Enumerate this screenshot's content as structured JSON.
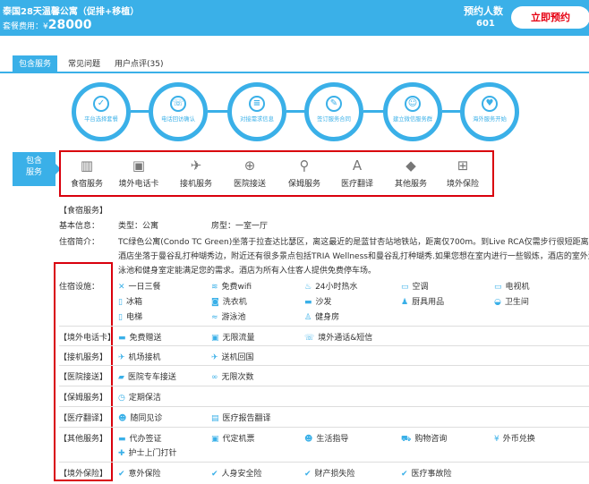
{
  "header": {
    "title": "泰国28天温馨公寓（促排+移植）",
    "fee_label": "套餐费用：¥",
    "fee_value": "28000",
    "count_label": "预约人数",
    "count_value": "601",
    "book_button": "立即预约"
  },
  "tabs": [
    "包含服务",
    "常见问题",
    "用户点评(35)"
  ],
  "steps": [
    "平台选择套餐",
    "电话回访确认",
    "对接需求信息",
    "签订服务合同",
    "建立微信服务群",
    "海外服务开始"
  ],
  "side_badge": "包含\n服务",
  "services": [
    "食宿服务",
    "境外电话卡",
    "接机服务",
    "医院接送",
    "保姆服务",
    "医疗翻译",
    "其他服务",
    "境外保险"
  ],
  "section_title": "【食宿服务】",
  "basic": {
    "label": "基本信息：",
    "type": "类型：公寓",
    "room": "房型：一室一厅"
  },
  "intro": {
    "label": "住宿简介：",
    "lines": [
      "TC绿色公寓(Condo TC Green)坐落于拉查达比瑟区，离这最近的是蓝甘杏站地铁站，距离仅700m。到Live RCA仅需步行很短距离。",
      "酒店坐落于曼谷乱打种瑚秀边，附近还有很多景点包括TRIA Wellness和曼谷乱打种瑚秀.如果您想在室内进行一些锻炼，酒店的室外游",
      "泳池和健身室定能满足您的需求。酒店为所有入住客人提供免费停车场。"
    ]
  },
  "facilities": {
    "label": "住宿设施：",
    "items": [
      "一日三餐",
      "免费wifi",
      "24小时热水",
      "空调",
      "电视机",
      "冰箱",
      "洗衣机",
      "沙发",
      "厨具用品",
      "卫生间",
      "电梯",
      "游泳池",
      "健身房"
    ]
  },
  "rows": [
    {
      "label": "【境外电话卡】",
      "items": [
        "免费赠送",
        "无限流量",
        "境外通话&短信"
      ]
    },
    {
      "label": "【接机服务】",
      "items": [
        "机场接机",
        "送机回国"
      ]
    },
    {
      "label": "【医院接送】",
      "items": [
        "医院专车接送",
        "无限次数"
      ]
    },
    {
      "label": "【保姆服务】",
      "items": [
        "定期保洁"
      ]
    },
    {
      "label": "【医疗翻译】",
      "items": [
        "随同见诊",
        "医疗报告翻译"
      ]
    },
    {
      "label": "【其他服务】",
      "items": [
        "代办签证",
        "代定机票",
        "生活指导",
        "购物咨询",
        "外币兑换",
        "护士上门打针"
      ]
    },
    {
      "label": "【境外保险】",
      "items": [
        "意外保险",
        "人身安全险",
        "财产损失险",
        "医疗事故险"
      ]
    }
  ],
  "icons": {
    "steps": [
      "tag-icon",
      "phone-check-icon",
      "document-icon",
      "contract-icon",
      "wechat-user-icon",
      "heart-icon"
    ],
    "services": [
      "building-icon",
      "sim-card-icon",
      "airplane-icon",
      "hospital-icon",
      "broom-icon",
      "translate-icon",
      "grid-icon",
      "insurance-icon"
    ]
  },
  "colors": {
    "brand": "#3ab0e8",
    "highlight": "#d9000d"
  }
}
